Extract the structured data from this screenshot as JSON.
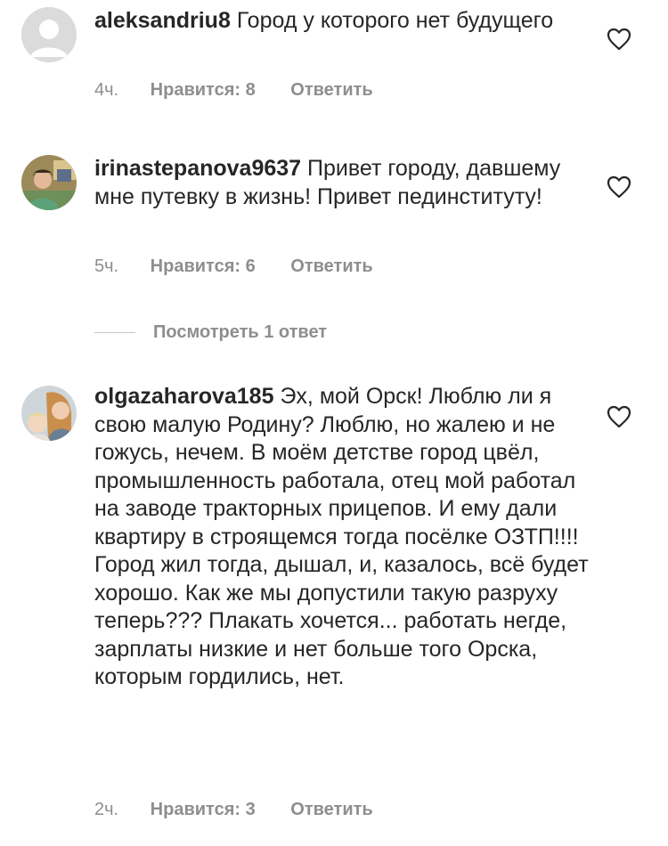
{
  "comments": [
    {
      "username": "aleksandriu8",
      "text": "Город у которого нет будущего",
      "time": "4ч.",
      "likes": "Нравится: 8",
      "reply": "Ответить"
    },
    {
      "username": "irinastepanova9637",
      "text": "Привет городу, давшему мне путевку в жизнь! Привет пединституту!",
      "time": "5ч.",
      "likes": "Нравится: 6",
      "reply": "Ответить",
      "view_replies": "Посмотреть 1 ответ"
    },
    {
      "username": "olgazaharova185",
      "text": "Эх, мой  Орск! Люблю ли я свою малую Родину? Люблю, но жалею и не гожусь, нечем. В моём детстве город цвёл, промышленность работала, отец мой работал на заводе тракторных прицепов. И ему дали квартиру в строящемся тогда посёлке ОЗТП!!!! Город жил тогда, дышал, и, казалось, всё будет хорошо. Как же мы допустили такую разруху теперь??? Плакать хочется... работать негде, зарплаты низкие и нет больше того Орска, которым гордились, нет.",
      "time": "2ч.",
      "likes": "Нравится: 3",
      "reply": "Ответить"
    }
  ],
  "icons": {
    "like": "heart-outline-icon",
    "default_avatar": "person-silhouette-icon"
  },
  "colors": {
    "text": "#262626",
    "muted": "#8e8e8e",
    "placeholder": "#dbdbdb"
  }
}
